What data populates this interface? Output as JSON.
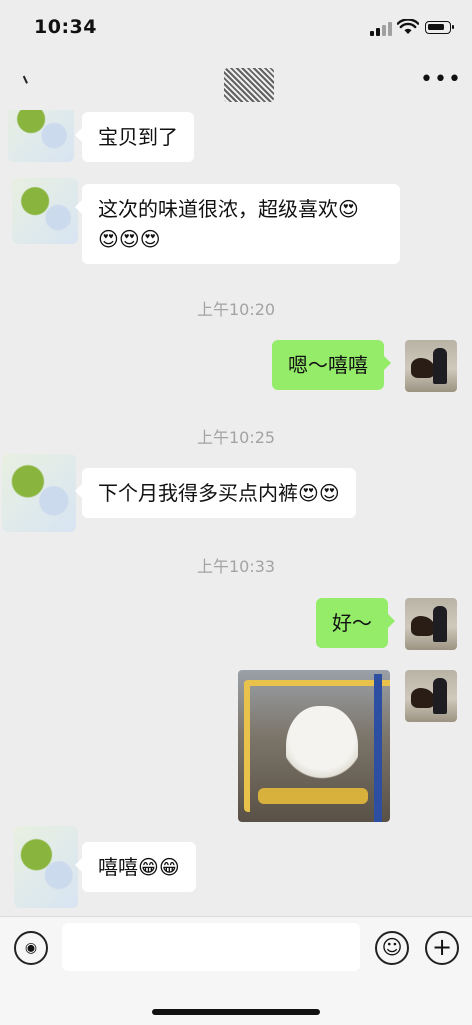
{
  "status": {
    "time": "10:34"
  },
  "nav": {
    "more_label": "•••"
  },
  "messages": {
    "m1": "宝贝到了",
    "m2_line1": "这次的味道很浓，超级喜欢😍",
    "m2_line2": "😍😍😍",
    "ts1": "上午10:20",
    "m3": "嗯～嘻嘻",
    "ts2": "上午10:25",
    "m4": "下个月我得多买点内裤😍😍",
    "ts3": "上午10:33",
    "m5": "好～",
    "m7": "嘻嘻😁😁"
  },
  "input": {
    "placeholder": ""
  },
  "icons": {
    "voice": "voice-icon",
    "emoji": "emoji-face-icon",
    "plus": "plus-icon",
    "more": "more-icon"
  },
  "colors": {
    "outgoing_bubble": "#95ec69",
    "incoming_bubble": "#ffffff",
    "background": "#ededed"
  }
}
